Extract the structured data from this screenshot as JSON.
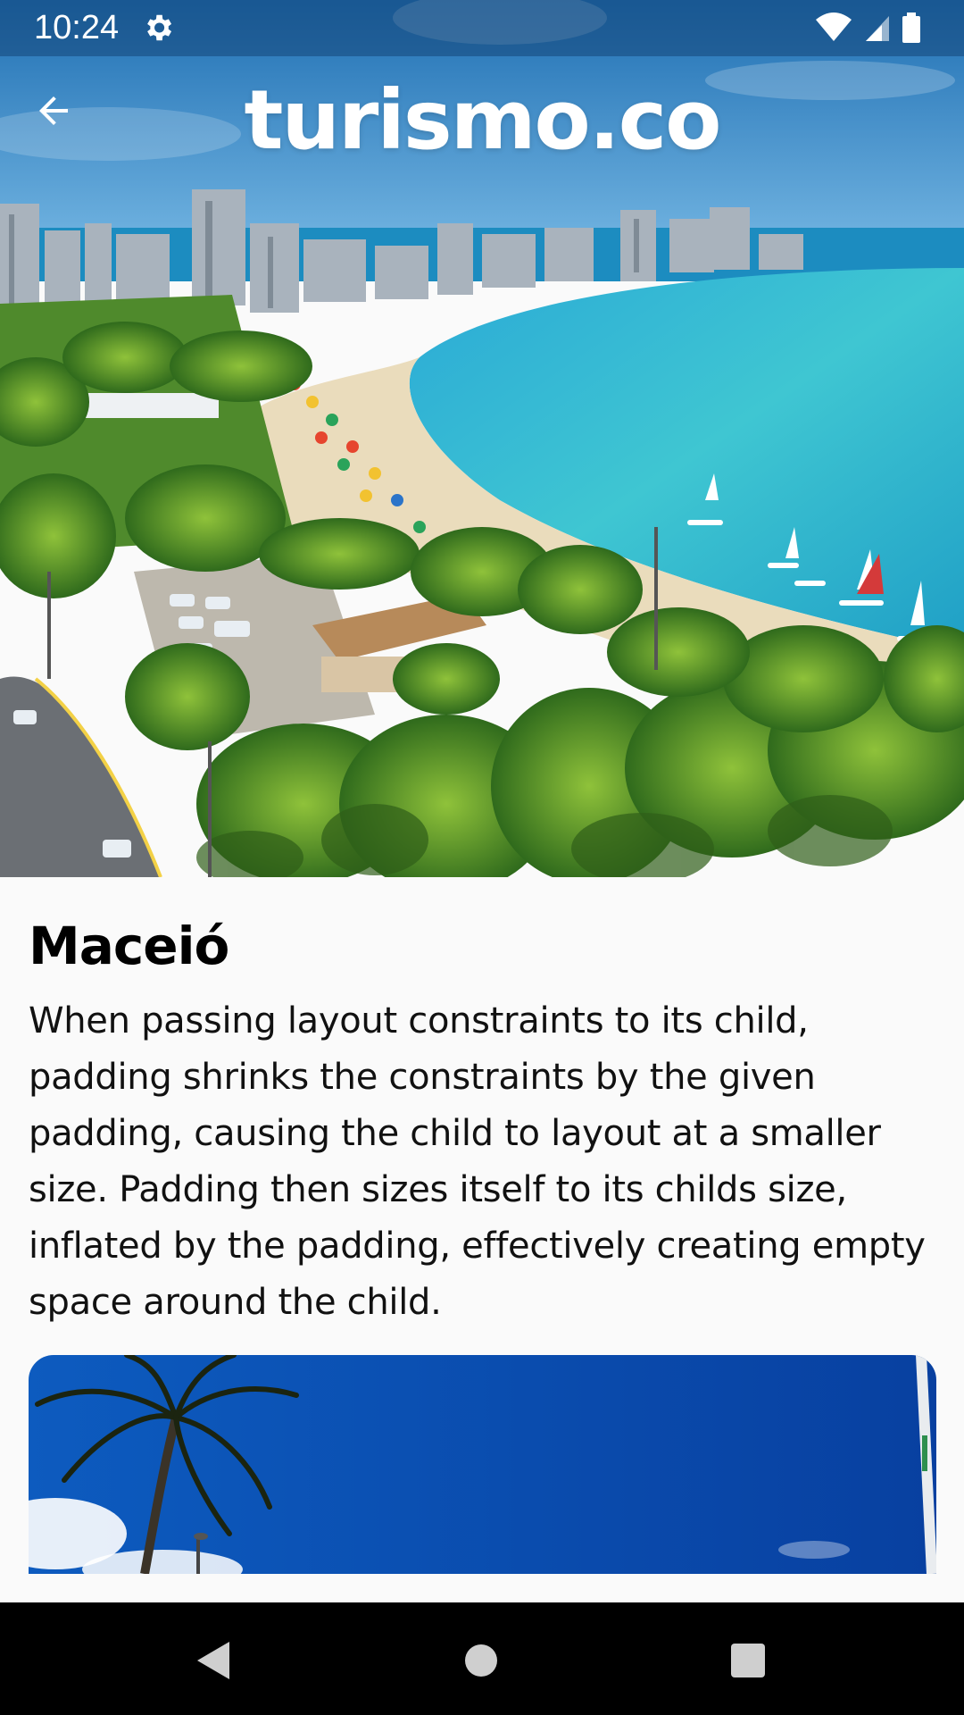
{
  "status_bar": {
    "time": "10:24",
    "settings_icon": "gear-icon",
    "wifi_icon": "wifi-icon",
    "signal_icon": "cell-signal-icon",
    "battery_icon": "battery-icon"
  },
  "app_bar": {
    "title": "turismo.co",
    "back_icon": "arrow-back-icon"
  },
  "place": {
    "name": "Maceió",
    "description": "When passing layout constraints to its child, padding shrinks the constraints by the given padding, causing the child to layout at a smaller size. Padding then sizes itself to its childs size, inflated by the padding, effectively creating empty space around the child."
  },
  "nav_bar": {
    "back_icon": "nav-back-triangle-icon",
    "home_icon": "nav-home-circle-icon",
    "recents_icon": "nav-recents-square-icon"
  },
  "colors": {
    "sky": "#2a7fc4",
    "sea": "#3fc3cf",
    "sand": "#e9d8b6",
    "foliage": "#3f7a26",
    "card_sky": "#0b4aa8",
    "background": "#fafafa",
    "nav_bar": "#000000"
  }
}
